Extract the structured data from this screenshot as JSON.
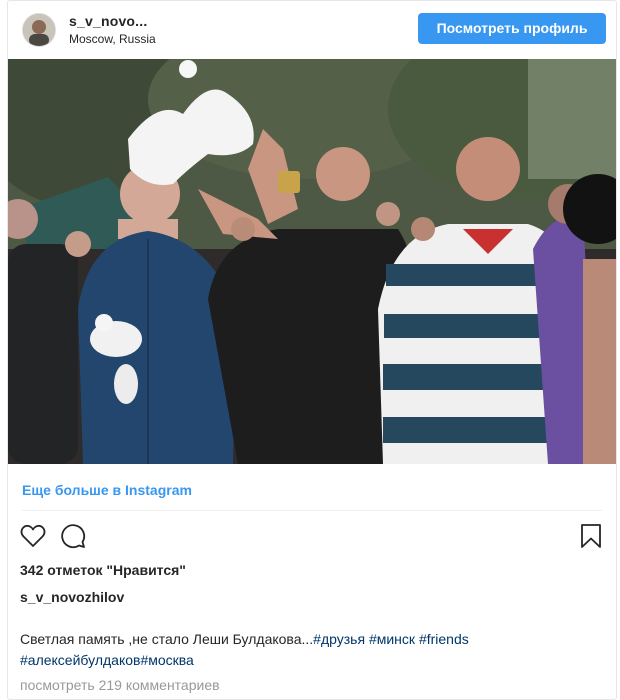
{
  "header": {
    "username": "s_v_novo...",
    "location": "Moscow, Russia",
    "view_profile_label": "Посмотреть профиль"
  },
  "more_link": "Еще больше в Instagram",
  "actions": {
    "like_icon": "heart-icon",
    "comment_icon": "comment-icon",
    "bookmark_icon": "bookmark-icon"
  },
  "likes_text": "342 отметок \"Нравится\"",
  "owner": "s_v_novozhilov",
  "caption": {
    "text": "Светлая память ,не стало Леши Булдакова...",
    "hashtags": [
      "#друзья",
      "#минск",
      "#friends",
      "#алексейбулдаков",
      "#москва"
    ]
  },
  "comments_text": "посмотреть 219 комментариев",
  "colors": {
    "accent": "#3897f0",
    "hashtag": "#003569",
    "text": "#262626",
    "muted": "#999999"
  }
}
